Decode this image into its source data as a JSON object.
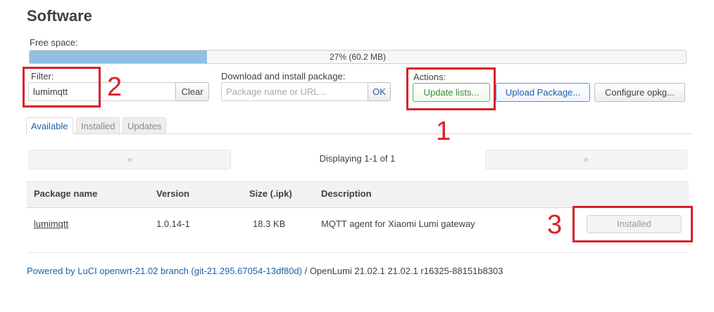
{
  "page": {
    "title": "Software"
  },
  "free_space": {
    "label": "Free space:",
    "text": "27% (60.2 MB)",
    "fraction": 0.27,
    "fill_color": "#90bfe3"
  },
  "filter": {
    "label": "Filter:",
    "value": "lumimqtt",
    "clear_label": "Clear"
  },
  "download": {
    "label": "Download and install package:",
    "placeholder": "Package name or URL...",
    "ok_label": "OK"
  },
  "actions": {
    "label": "Actions:",
    "update_label": "Update lists...",
    "upload_label": "Upload Package...",
    "configure_label": "Configure opkg..."
  },
  "tabs": [
    {
      "label": "Available",
      "active": true
    },
    {
      "label": "Installed",
      "active": false
    },
    {
      "label": "Updates",
      "active": false
    }
  ],
  "pager": {
    "prev": "«",
    "status": "Displaying 1-1 of 1",
    "next": "»"
  },
  "table": {
    "headers": [
      "Package name",
      "Version",
      "Size (.ipk)",
      "Description"
    ],
    "rows": [
      {
        "name": "lumimqtt",
        "version": "1.0.14-1",
        "size": "18.3 KB",
        "description": "MQTT agent for Xiaomi Lumi gateway",
        "action": "Installed"
      }
    ]
  },
  "annotations": {
    "one": "1",
    "two": "2",
    "three": "3",
    "color": "#d9202a"
  },
  "footer": {
    "link_text": "Powered by LuCI openwrt-21.02 branch (git-21.295.67054-13df80d)",
    "rest": " / OpenLumi 21.02.1 21.02.1 r16325-88151b8303"
  },
  "colors": {
    "link": "#1f5fa8",
    "success": "#5cb85c"
  }
}
